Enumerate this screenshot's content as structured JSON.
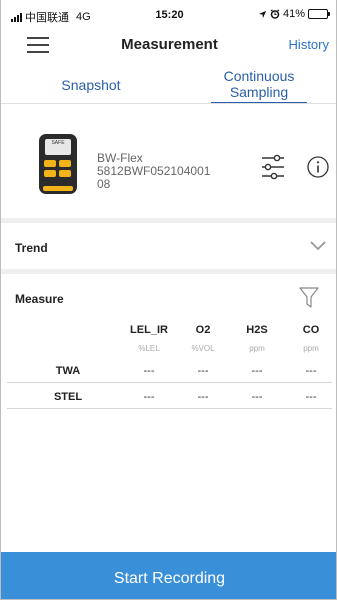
{
  "status_bar": {
    "carrier": "中国联通",
    "network": "4G",
    "time": "15:20",
    "battery": "41%",
    "battery_level": 0.41
  },
  "header": {
    "title": "Measurement",
    "history_label": "History"
  },
  "tabs": [
    {
      "label": "Snapshot",
      "active": false
    },
    {
      "label": "Continuous Sampling",
      "active": true
    }
  ],
  "device": {
    "screen_text": "SAFE",
    "name_line1": "BW-Flex",
    "name_line2": "5812BWF052104001",
    "name_line3": "08"
  },
  "trend": {
    "label": "Trend"
  },
  "measure": {
    "label": "Measure",
    "columns": [
      {
        "name": "LEL_IR",
        "unit": "%LEL"
      },
      {
        "name": "O2",
        "unit": "%VOL"
      },
      {
        "name": "H2S",
        "unit": "ppm"
      },
      {
        "name": "CO",
        "unit": "ppm"
      }
    ],
    "rows": [
      {
        "label": "TWA",
        "values": [
          "---",
          "---",
          "---",
          "---"
        ]
      },
      {
        "label": "STEL",
        "values": [
          "---",
          "---",
          "---",
          "---"
        ]
      }
    ]
  },
  "footer": {
    "button_label": "Start Recording"
  },
  "colors": {
    "accent": "#2a73c9",
    "tab_text": "#2a5fa8",
    "footer_button": "#3a8fd9",
    "device_accent": "#f3b419"
  },
  "icons": [
    "menu-icon",
    "location-arrow-icon",
    "alarm-icon",
    "battery-icon",
    "settings-sliders-icon",
    "info-icon",
    "chevron-down-icon",
    "filter-icon"
  ]
}
